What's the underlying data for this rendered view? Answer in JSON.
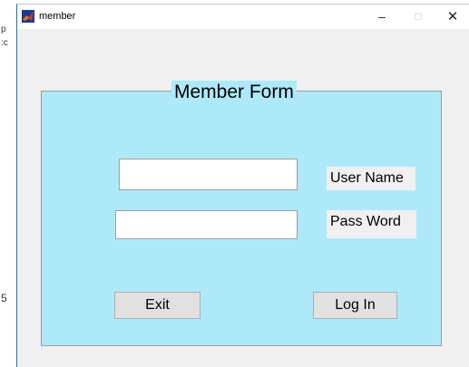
{
  "window": {
    "title": "member",
    "minimize_glyph": "–",
    "maximize_glyph": "□",
    "close_glyph": "✕"
  },
  "background_fragments": [
    "p",
    ":c",
    "5"
  ],
  "panel": {
    "title": "Member Form"
  },
  "form": {
    "username_value": "",
    "password_value": "",
    "username_label": "User Name",
    "password_label": "Pass Word"
  },
  "buttons": {
    "exit_label": "Exit",
    "login_label": "Log In"
  },
  "colors": {
    "panel_bg": "#aee9fa",
    "window_bg": "#f0f0f0",
    "button_bg": "#e1e1e1"
  }
}
